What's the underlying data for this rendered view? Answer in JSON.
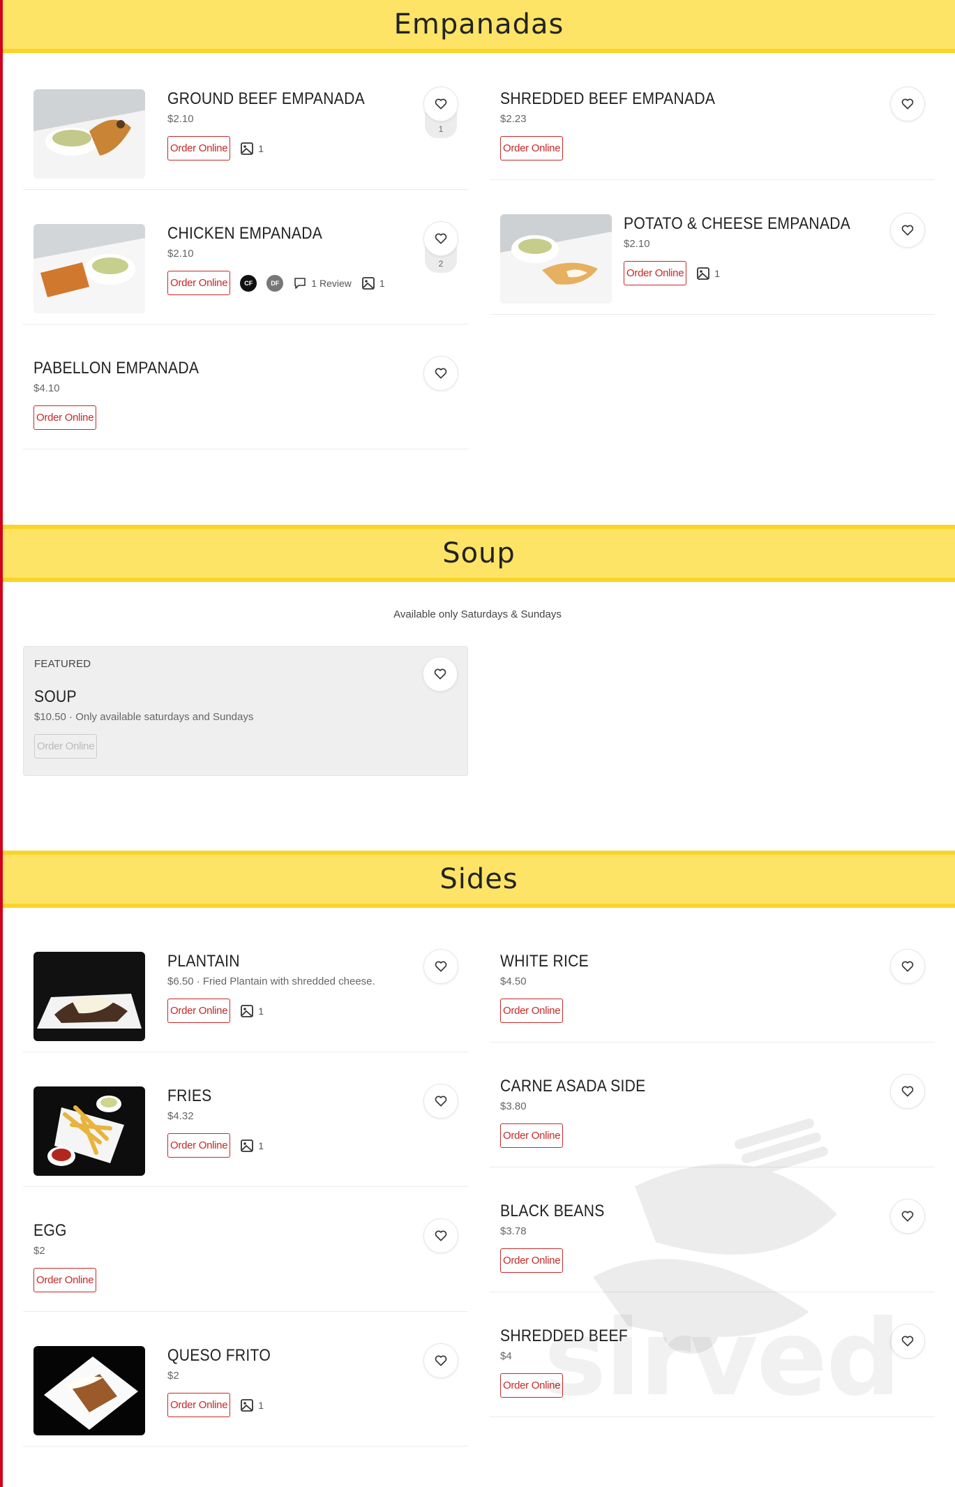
{
  "sections": {
    "empanadas": {
      "title": "Empanadas"
    },
    "soup": {
      "title": "Soup",
      "note": "Available only Saturdays & Sundays"
    },
    "sides": {
      "title": "Sides"
    }
  },
  "order_label": "Order Online",
  "featured_label": "FEATURED",
  "items": {
    "ground_beef": {
      "name": "GROUND BEEF EMPANADA",
      "price": "$2.10",
      "photos": "1",
      "likes": "1"
    },
    "shredded_beef_emp": {
      "name": "SHREDDED BEEF EMPANADA",
      "price": "$2.23"
    },
    "chicken": {
      "name": "CHICKEN EMPANADA",
      "price": "$2.10",
      "badge1": "CF",
      "badge2": "DF",
      "reviews": "1 Review",
      "photos": "1",
      "likes": "2"
    },
    "potato_cheese": {
      "name": "POTATO & CHEESE EMPANADA",
      "price": "$2.10",
      "photos": "1"
    },
    "pabellon": {
      "name": "PABELLON EMPANADA",
      "price": "$4.10"
    },
    "soup": {
      "name": "SOUP",
      "price": "$10.50 · Only available saturdays and Sundays"
    },
    "plantain": {
      "name": "PLANTAIN",
      "price": "$6.50 · Fried Plantain with shredded cheese.",
      "photos": "1"
    },
    "white_rice": {
      "name": "WHITE RICE",
      "price": "$4.50"
    },
    "fries": {
      "name": "FRIES",
      "price": "$4.32",
      "photos": "1"
    },
    "carne_asada": {
      "name": "CARNE ASADA SIDE",
      "price": "$3.80"
    },
    "egg": {
      "name": "EGG",
      "price": "$2"
    },
    "black_beans": {
      "name": "BLACK BEANS",
      "price": "$3.78"
    },
    "queso_frito": {
      "name": "QUESO FRITO",
      "price": "$2",
      "photos": "1"
    },
    "shredded_beef": {
      "name": "SHREDDED BEEF",
      "price": "$4"
    }
  },
  "watermark": "sirved",
  "colors": {
    "header_bg": "#fde466",
    "header_border": "#fbd428",
    "accent": "#c62828",
    "rule": "#d0021b"
  }
}
